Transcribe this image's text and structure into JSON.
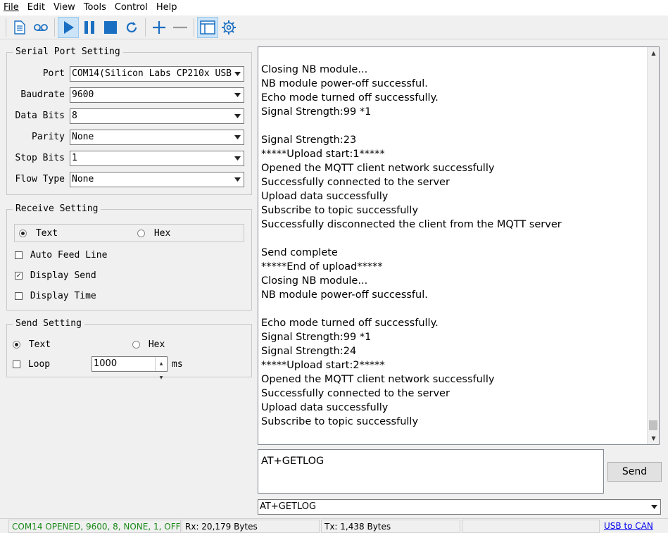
{
  "menu": [
    "File",
    "Edit",
    "View",
    "Tools",
    "Control",
    "Help"
  ],
  "toolbar": {
    "icons": [
      "document-icon",
      "tape-icon",
      "play-icon",
      "pause-icon",
      "stop-icon",
      "refresh-icon",
      "plus-icon",
      "minus-icon",
      "window-icon",
      "gear-icon"
    ]
  },
  "serial": {
    "title": "Serial Port Setting",
    "port_label": "Port",
    "port_value": "COM14(Silicon Labs CP210x USB",
    "baud_label": "Baudrate",
    "baud_value": "9600",
    "databits_label": "Data Bits",
    "databits_value": "8",
    "parity_label": "Parity",
    "parity_value": "None",
    "stopbits_label": "Stop Bits",
    "stopbits_value": "1",
    "flow_label": "Flow Type",
    "flow_value": "None"
  },
  "receive": {
    "title": "Receive Setting",
    "text_label": "Text",
    "hex_label": "Hex",
    "auto_feed_label": "Auto Feed Line",
    "display_send_label": "Display Send",
    "display_time_label": "Display Time",
    "selected_mode": "Text",
    "auto_feed": false,
    "display_send": true,
    "display_time": false
  },
  "send": {
    "title": "Send Setting",
    "text_label": "Text",
    "hex_label": "Hex",
    "loop_label": "Loop",
    "loop_value": "1000",
    "loop_unit": "ms",
    "selected_mode": "Text",
    "loop": false
  },
  "output": {
    "lines": [
      "Closing NB module...",
      "NB module power-off successful.",
      "Echo mode turned off successfully.",
      "Signal Strength:99 *1",
      "",
      "Signal Strength:23",
      "*****Upload start:1*****",
      "Opened the MQTT client network successfully",
      "Successfully connected to the server",
      "Upload data successfully",
      "Subscribe to topic successfully",
      "Successfully disconnected the client from the MQTT server",
      "",
      "Send complete",
      "*****End of upload*****",
      "Closing NB module...",
      "NB module power-off successful.",
      "",
      "Echo mode turned off successfully.",
      "Signal Strength:99 *1",
      "Signal Strength:24",
      "*****Upload start:2*****",
      "Opened the MQTT client network successfully",
      "Successfully connected to the server",
      "Upload data successfully",
      "Subscribe to topic successfully"
    ]
  },
  "send_area": {
    "input_value": "AT+GETLOG",
    "send_label": "Send",
    "history_value": "AT+GETLOG"
  },
  "status": {
    "port_status": "COM14 OPENED, 9600, 8, NONE, 1, OFF",
    "rx": "Rx: 20,179 Bytes",
    "tx": "Tx: 1,438 Bytes",
    "link": "USB to CAN"
  },
  "colors": {
    "status_green": "#1a8a1a",
    "link_blue": "#0000ee",
    "accent_blue": "#1a6fc2"
  }
}
